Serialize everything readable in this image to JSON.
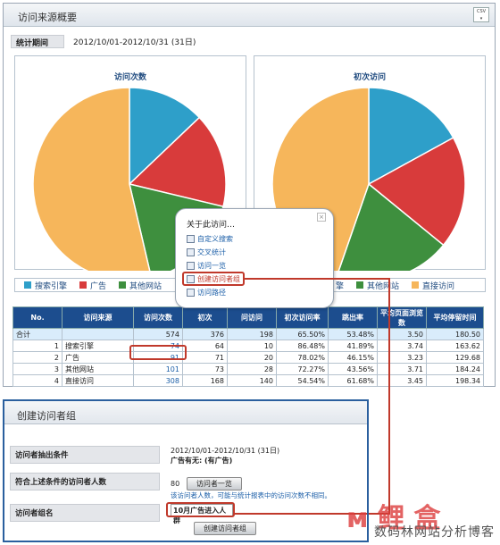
{
  "overview": {
    "title": "访问来源概要",
    "csv_label": "CSV",
    "period_label": "统计期间",
    "period_value": "2012/10/01-2012/10/31 (31日)"
  },
  "charts": {
    "left_title": "访问次数",
    "right_title": "初次访问"
  },
  "chart_data": [
    {
      "type": "pie",
      "title": "访问次数",
      "categories": [
        "搜索引擎",
        "广告",
        "其他网站",
        "直接访问"
      ],
      "values": [
        74,
        91,
        101,
        308
      ],
      "colors": [
        "#2e9fc9",
        "#d83b3b",
        "#3e8f3e",
        "#f6b65b"
      ]
    },
    {
      "type": "pie",
      "title": "初次访问",
      "categories": [
        "搜索引擎",
        "广告",
        "其他网站",
        "直接访问"
      ],
      "values": [
        64,
        71,
        73,
        168
      ],
      "colors": [
        "#2e9fc9",
        "#d83b3b",
        "#3e8f3e",
        "#f6b65b"
      ]
    }
  ],
  "legend": {
    "items": [
      {
        "label": "搜索引擎",
        "color": "#2e9fc9"
      },
      {
        "label": "广告",
        "color": "#d83b3b"
      },
      {
        "label": "其他网站",
        "color": "#3e8f3e"
      }
    ],
    "right_items": [
      {
        "label": "擎",
        "color": "#2e9fc9"
      },
      {
        "label": "其他网站",
        "color": "#3e8f3e"
      },
      {
        "label": "直接访问",
        "color": "#f6b65b"
      }
    ]
  },
  "popup": {
    "title": "关于此访问…",
    "items": [
      "自定义搜索",
      "交叉统计",
      "访问一览",
      "创建访问者组",
      "访问路径"
    ],
    "close": "×"
  },
  "table": {
    "headers": [
      "No.",
      "访问来源",
      "访问次数",
      "初次",
      "问访问",
      "初次访问率",
      "跳出率",
      "平均页面浏览数",
      "平均停留时间"
    ],
    "total": [
      "合计",
      "",
      "574",
      "376",
      "198",
      "65.50%",
      "53.48%",
      "3.50",
      "180.50"
    ],
    "rows": [
      [
        "1",
        "搜索引擎",
        "74",
        "64",
        "10",
        "86.48%",
        "41.89%",
        "3.74",
        "163.62"
      ],
      [
        "2",
        "广告",
        "91",
        "71",
        "20",
        "78.02%",
        "46.15%",
        "3.23",
        "129.68"
      ],
      [
        "3",
        "其他网站",
        "101",
        "73",
        "28",
        "72.27%",
        "43.56%",
        "3.71",
        "184.24"
      ],
      [
        "4",
        "直接访问",
        "308",
        "168",
        "140",
        "54.54%",
        "61.68%",
        "3.45",
        "198.34"
      ]
    ]
  },
  "create_group": {
    "title": "创建访问者组",
    "cond_label": "访问者抽出条件",
    "cond_value": "2012/10/01-2012/10/31 (31日)",
    "cond_value2": "广告有无: (有广告)",
    "count_label": "符合上述条件的访问者人数",
    "count_value": "80",
    "list_button": "访问者一览",
    "note": "该访问者人数，可能与统计报表中的访问次数不相同。",
    "name_label": "访问者组名",
    "name_value": "10月广告进入人群",
    "create_button": "创建访问者组"
  },
  "watermark": "数码林网站分析博客",
  "watermark_logo": "ᴍ 鲤 盒"
}
